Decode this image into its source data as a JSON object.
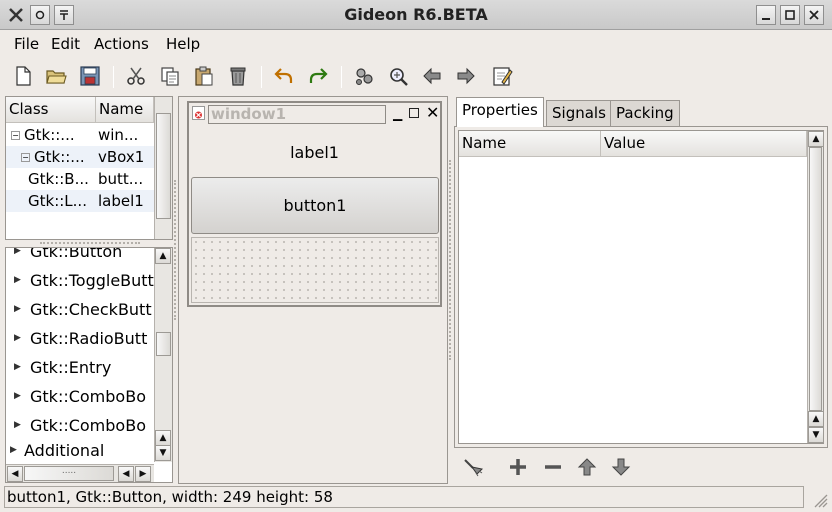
{
  "window": {
    "title": "Gideon R6.BETA",
    "controls": [
      "minimize",
      "maximize",
      "close"
    ]
  },
  "menubar": {
    "items": [
      "File",
      "Edit",
      "Actions",
      "Help"
    ]
  },
  "toolbar": {
    "icons": [
      "new-file-icon",
      "open-folder-icon",
      "save-icon",
      "cut-icon",
      "copy-icon",
      "paste-icon",
      "delete-icon",
      "undo-icon",
      "redo-icon",
      "build-icon",
      "zoom-icon",
      "arrow-left-icon",
      "arrow-right-icon",
      "edit-icon"
    ]
  },
  "widget_tree": {
    "columns": [
      "Class",
      "Name"
    ],
    "rows": [
      {
        "class": "Gtk::...",
        "name": "win..."
      },
      {
        "class": "Gtk::...",
        "name": "vBox1"
      },
      {
        "class": "Gtk::B...",
        "name": "butt..."
      },
      {
        "class": "Gtk::L...",
        "name": "label1"
      }
    ]
  },
  "palette": {
    "items": [
      "Gtk::Button",
      "Gtk::ToggleButt",
      "Gtk::CheckButt",
      "Gtk::RadioButt",
      "Gtk::Entry",
      "Gtk::ComboBo",
      "Gtk::ComboBo"
    ],
    "group": "Additional",
    "hscroll_thumb": "....."
  },
  "designer": {
    "window_title": "window1",
    "label": "label1",
    "button": "button1"
  },
  "properties": {
    "tabs": [
      "Properties",
      "Signals",
      "Packing"
    ],
    "active_tab": "Properties",
    "columns": [
      "Name",
      "Value"
    ]
  },
  "prop_toolbar": {
    "icons": [
      "brush-icon",
      "add-icon",
      "remove-icon",
      "move-up-icon",
      "move-down-icon"
    ]
  },
  "status": {
    "text": "button1, Gtk::Button, width: 249 height: 58"
  }
}
